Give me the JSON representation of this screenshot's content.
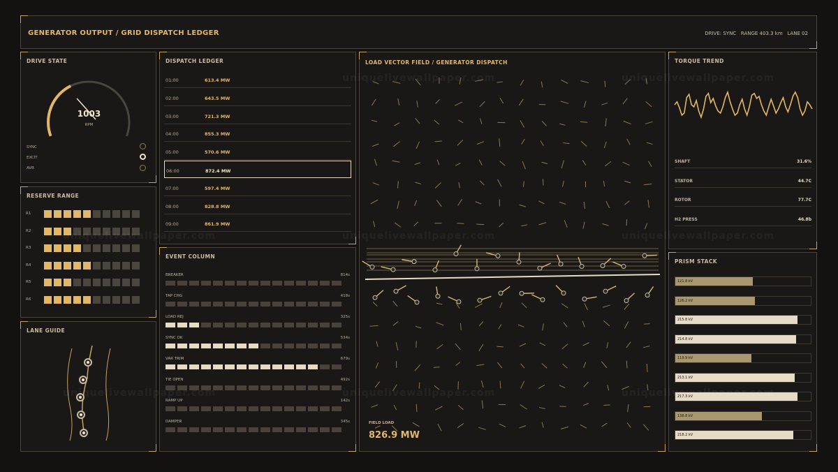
{
  "header": {
    "title": "GENERATOR OUTPUT / GRID DISPATCH LEDGER",
    "meta": "DRIVE: SYNC   RANGE 403.3 km   LANE 02"
  },
  "drive_state": {
    "title": "DRIVE STATE",
    "rpm_value": "1003",
    "rpm_unit": "RPM",
    "gauge_level": 0.38,
    "indicators": [
      {
        "label": "SYNC",
        "on": false
      },
      {
        "label": "EXCIT",
        "on": true
      },
      {
        "label": "AVR",
        "on": false
      }
    ]
  },
  "reserve_range": {
    "title": "RESERVE RANGE",
    "rows": [
      {
        "label": "R1",
        "filled": 5
      },
      {
        "label": "R2",
        "filled": 3
      },
      {
        "label": "R3",
        "filled": 4
      },
      {
        "label": "R4",
        "filled": 5
      },
      {
        "label": "R5",
        "filled": 3
      },
      {
        "label": "R6",
        "filled": 5
      }
    ],
    "total_cells": 10
  },
  "lane_guide": {
    "title": "LANE GUIDE"
  },
  "dispatch_ledger": {
    "title": "DISPATCH LEDGER",
    "rows": [
      {
        "time": "01:00",
        "value": "613.4 MW"
      },
      {
        "time": "02:00",
        "value": "643.5 MW"
      },
      {
        "time": "03:00",
        "value": "721.3 MW"
      },
      {
        "time": "04:00",
        "value": "855.3 MW"
      },
      {
        "time": "05:00",
        "value": "570.6 MW"
      },
      {
        "time": "06:00",
        "value": "872.4 MW",
        "selected": true
      },
      {
        "time": "07:00",
        "value": "597.4 MW"
      },
      {
        "time": "08:00",
        "value": "828.8 MW"
      },
      {
        "time": "09:00",
        "value": "861.9 MW"
      }
    ]
  },
  "event_column": {
    "title": "EVENT COLUMN",
    "total_cells": 15,
    "rows": [
      {
        "label": "BREAKER",
        "duration": "814s",
        "active": 0
      },
      {
        "label": "TAP CHG",
        "duration": "418s",
        "active": 0
      },
      {
        "label": "LOAD REJ",
        "duration": "325s",
        "active": 3
      },
      {
        "label": "SYNC OK",
        "duration": "534s",
        "active": 8
      },
      {
        "label": "VAR TRIM",
        "duration": "679s",
        "active": 13
      },
      {
        "label": "TIE OPEN",
        "duration": "492s",
        "active": 0
      },
      {
        "label": "RAMP UP",
        "duration": "142s",
        "active": 0
      },
      {
        "label": "DAMPER",
        "duration": "345s",
        "active": 0
      }
    ]
  },
  "vector_field": {
    "title": "LOAD VECTOR FIELD / GENERATOR DISPATCH",
    "field_load_label": "FIELD LOAD",
    "field_load_value": "826.9 MW"
  },
  "torque_trend": {
    "title": "TORQUE TREND",
    "trend": [
      0.55,
      0.62,
      0.48,
      0.3,
      0.35,
      0.72,
      0.8,
      0.55,
      0.5,
      0.65,
      0.4,
      0.25,
      0.45,
      0.75,
      0.82,
      0.6,
      0.7,
      0.52,
      0.4,
      0.35,
      0.5,
      0.72,
      0.85,
      0.62,
      0.45,
      0.3,
      0.35,
      0.55,
      0.68,
      0.45,
      0.3,
      0.5,
      0.78,
      0.82,
      0.7,
      0.75,
      0.55,
      0.4,
      0.3,
      0.5,
      0.68,
      0.52,
      0.35,
      0.45,
      0.6,
      0.72,
      0.5,
      0.38,
      0.55,
      0.75,
      0.85,
      0.72,
      0.45,
      0.3,
      0.4,
      0.62,
      0.55,
      0.45
    ],
    "rows": [
      {
        "label": "SHAFT",
        "value": "31.6%"
      },
      {
        "label": "STATOR",
        "value": "44.7C"
      },
      {
        "label": "ROTOR",
        "value": "77.7C"
      },
      {
        "label": "H2 PRESS",
        "value": "46.8b"
      }
    ]
  },
  "prism_stack": {
    "title": "PRISM STACK",
    "rows": [
      {
        "label": "121.8 kV",
        "level": 0.57,
        "bright": false
      },
      {
        "label": "126.2 kV",
        "level": 0.59,
        "bright": false
      },
      {
        "label": "215.8 kV",
        "level": 0.9,
        "bright": true
      },
      {
        "label": "214.8 kV",
        "level": 0.89,
        "bright": true
      },
      {
        "label": "119.9 kV",
        "level": 0.56,
        "bright": false
      },
      {
        "label": "213.1 kV",
        "level": 0.88,
        "bright": true
      },
      {
        "label": "217.3 kV",
        "level": 0.9,
        "bright": true
      },
      {
        "label": "138.8 kV",
        "level": 0.64,
        "bright": false
      },
      {
        "label": "218.2 kV",
        "level": 0.87,
        "bright": true
      }
    ]
  },
  "watermark": "uniquelivewallpaper.com",
  "colors": {
    "accent": "#e2b766",
    "light": "#e6dcc6",
    "dim": "#a8986f"
  }
}
